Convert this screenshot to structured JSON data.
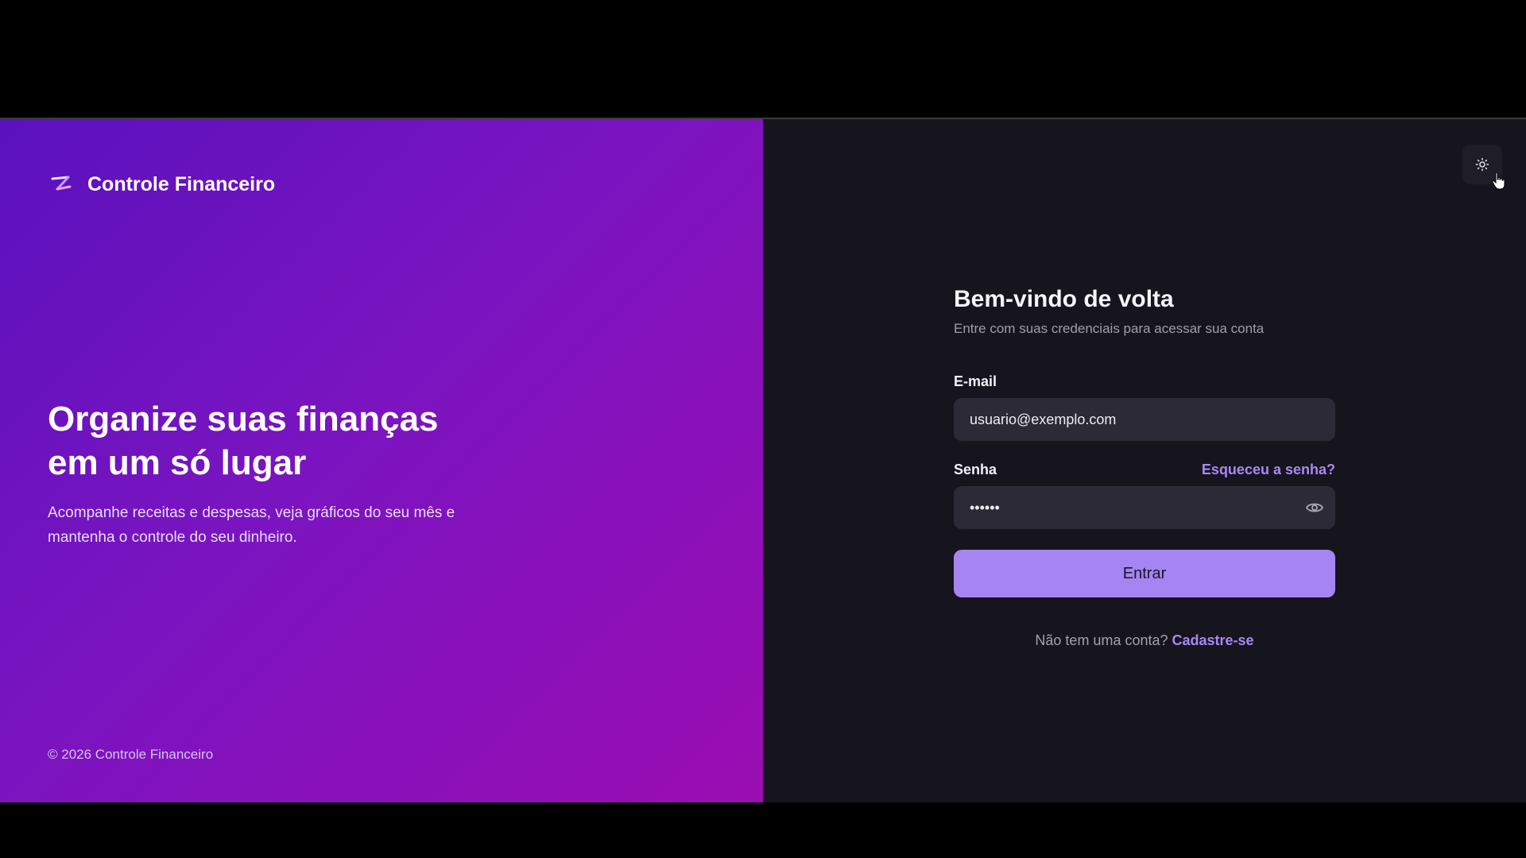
{
  "brand": {
    "name": "Controle Financeiro",
    "logo_icon": "finance-logo-icon"
  },
  "hero": {
    "title_line1": "Organize suas finanças",
    "title_line2": "em um só lugar",
    "description_line1": "Acompanhe receitas e despesas, veja gráficos do seu mês e",
    "description_line2": "mantenha o controle do seu dinheiro."
  },
  "footer": {
    "copyright": "© 2026 Controle Financeiro"
  },
  "theme_toggle": {
    "icon": "sun-icon"
  },
  "login": {
    "title": "Bem-vindo de volta",
    "subtitle": "Entre com suas credenciais para acessar sua conta",
    "email": {
      "label": "E-mail",
      "placeholder": "usuario@exemplo.com",
      "value": "usuario@exemplo.com"
    },
    "password": {
      "label": "Senha",
      "value": "••••••",
      "forgot_label": "Esqueceu a senha?",
      "toggle_icon": "eye-icon"
    },
    "submit_label": "Entrar",
    "signup_prompt": "Não tem uma conta?",
    "signup_label": "Cadastre-se"
  },
  "colors": {
    "gradient_start": "#5a12bd",
    "gradient_end": "#9a0db2",
    "panel_dark": "#16141d",
    "input_bg": "#2b2a36",
    "accent": "#a585f2",
    "link": "#a689f5"
  }
}
